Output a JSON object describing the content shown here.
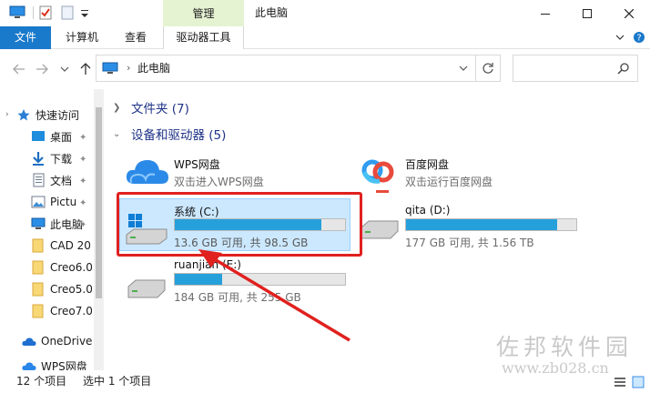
{
  "window": {
    "title": "此电脑",
    "context_header": "管理"
  },
  "ribbon": {
    "tabs": [
      "文件",
      "计算机",
      "查看"
    ],
    "context_tab": "驱动器工具"
  },
  "address": {
    "path": "此电脑",
    "search_placeholder": ""
  },
  "sidebar": {
    "items": [
      {
        "label": "快速访问",
        "icon": "star-icon"
      },
      {
        "label": "桌面",
        "icon": "desktop-icon",
        "pinned": true
      },
      {
        "label": "下载",
        "icon": "download-icon",
        "pinned": true
      },
      {
        "label": "文档",
        "icon": "documents-icon",
        "pinned": true
      },
      {
        "label": "Pictu",
        "icon": "pictures-icon",
        "pinned": true
      },
      {
        "label": "此电脑",
        "icon": "computer-icon",
        "pinned": true
      },
      {
        "label": "CAD 20",
        "icon": "folder-icon"
      },
      {
        "label": "Creo6.0",
        "icon": "folder-icon"
      },
      {
        "label": "Creo5.0",
        "icon": "folder-icon"
      },
      {
        "label": "Creo7.0",
        "icon": "folder-icon"
      },
      {
        "label": "OneDrive",
        "icon": "onedrive-icon"
      },
      {
        "label": "WPS网盘",
        "icon": "wps-cloud-icon"
      }
    ]
  },
  "groups": {
    "folders": "文件夹 (7)",
    "devices": "设备和驱动器 (5)"
  },
  "devices": {
    "wps": {
      "title": "WPS网盘",
      "subtitle": "双击进入WPS网盘"
    },
    "baidu": {
      "title": "百度网盘",
      "subtitle": "双击运行百度网盘"
    },
    "c": {
      "title": "系统 (C:)",
      "info": "13.6 GB 可用, 共 98.5 GB",
      "used_fraction": 0.862
    },
    "d": {
      "title": "qita (D:)",
      "info": "177 GB 可用, 共 1.56 TB",
      "used_fraction": 0.889
    },
    "e": {
      "title": "ruanjian (E:)",
      "info": "184 GB 可用, 共 255 GB",
      "used_fraction": 0.278
    }
  },
  "status": {
    "count": "12 个项目",
    "selection": "选中 1 个项目"
  },
  "watermark": {
    "text": "佐邦软件园",
    "url": "www.zb028.cn"
  },
  "colors": {
    "accent": "#1979ca",
    "selection": "#cce8ff",
    "bar_fill": "#26a0da",
    "annotation_red": "#e0211f"
  }
}
